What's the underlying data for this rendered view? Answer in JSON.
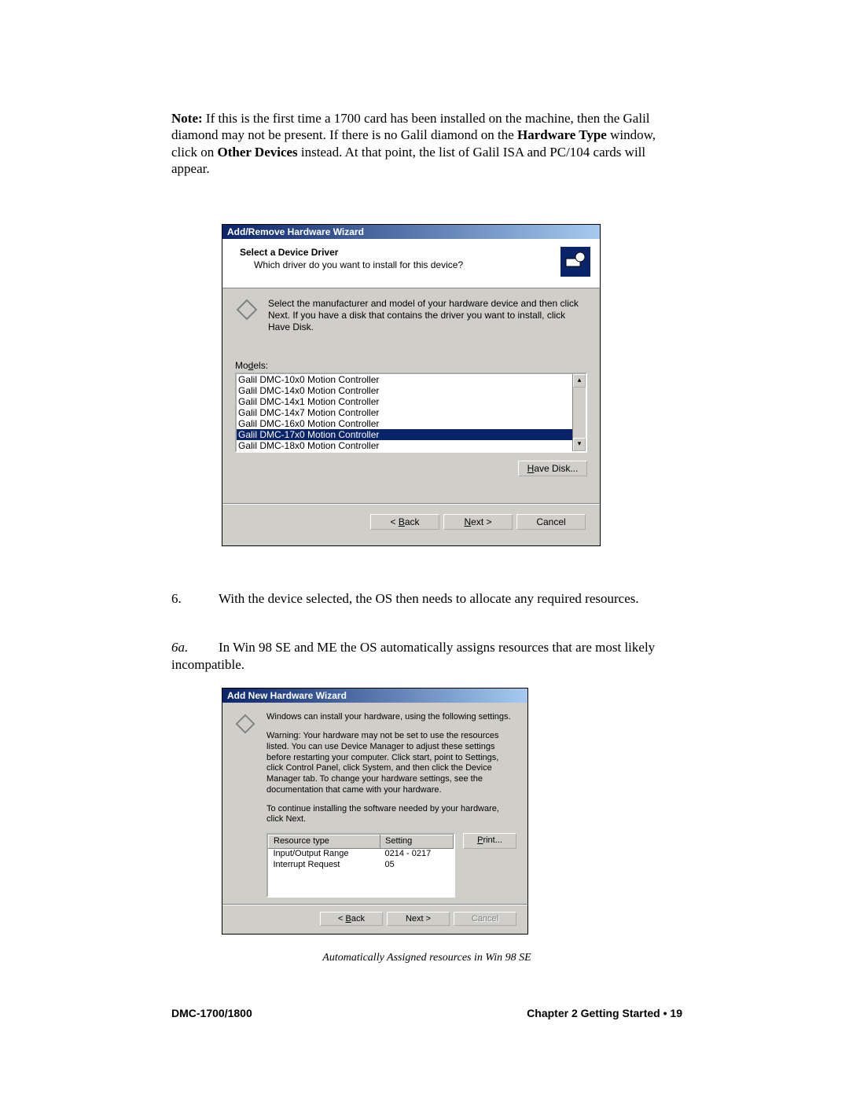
{
  "note": {
    "label": "Note:",
    "body1": "  If this is the first time a 1700 card has been installed on the machine, then the Galil diamond may not be present.  If there is no Galil diamond on the ",
    "hw": "Hardware Type",
    "body2": " window, click on ",
    "od": "Other Devices",
    "body3": " instead.  At that point, the list of Galil ISA and PC/104 cards will appear."
  },
  "dialog1": {
    "title": "Add/Remove Hardware Wizard",
    "heading": "Select a Device Driver",
    "subheading": "Which driver do you want to install for this device?",
    "info": "Select the manufacturer and model of your hardware device and then click Next. If you have a disk that contains the driver you want to install, click Have Disk.",
    "models_label_pre": "Mo",
    "models_label_u": "d",
    "models_label_post": "els:",
    "items": [
      "Galil DMC-10x0 Motion Controller",
      "Galil DMC-14x0 Motion Controller",
      "Galil DMC-14x1 Motion Controller",
      "Galil DMC-14x7 Motion Controller",
      "Galil DMC-16x0 Motion Controller",
      "Galil DMC-17x0 Motion Controller",
      "Galil DMC-18x0 Motion Controller"
    ],
    "selected_index": 5,
    "have_disk_pre": "",
    "have_disk_u": "H",
    "have_disk_post": "ave Disk...",
    "back_pre": "< ",
    "back_u": "B",
    "back_post": "ack",
    "next_pre": "",
    "next_u": "N",
    "next_post": "ext >",
    "cancel": "Cancel"
  },
  "step6": {
    "num": "6.",
    "text": "With the device selected, the OS then needs to allocate any required resources."
  },
  "step6a": {
    "num": "6a.",
    "text_lead": "In Win 98 SE and ME the OS automatically assigns resources that are most likely ",
    "text_tail": "incompatible."
  },
  "dialog2": {
    "title": "Add New Hardware Wizard",
    "line1": "Windows can install your hardware, using the following settings.",
    "warn": "Warning: Your hardware may not be set to use the resources listed. You can use Device Manager to adjust these settings before restarting your computer. Click start, point to Settings, click Control Panel, click System, and then click the Device Manager tab. To change your hardware settings, see the documentation that came with your hardware.",
    "cont": "To continue installing the software needed by your hardware, click Next.",
    "col1": "Resource type",
    "col2": "Setting",
    "rows": [
      {
        "type": "Input/Output Range",
        "setting": "0214 - 0217"
      },
      {
        "type": "Interrupt Request",
        "setting": "05"
      }
    ],
    "print_u": "P",
    "print_post": "rint...",
    "back_pre": "< ",
    "back_u": "B",
    "back_post": "ack",
    "next": "Next >",
    "cancel": "Cancel"
  },
  "caption": "Automatically Assigned resources in Win 98 SE",
  "footer": {
    "left": "DMC-1700/1800",
    "right": "Chapter 2 Getting Started  •  19"
  }
}
